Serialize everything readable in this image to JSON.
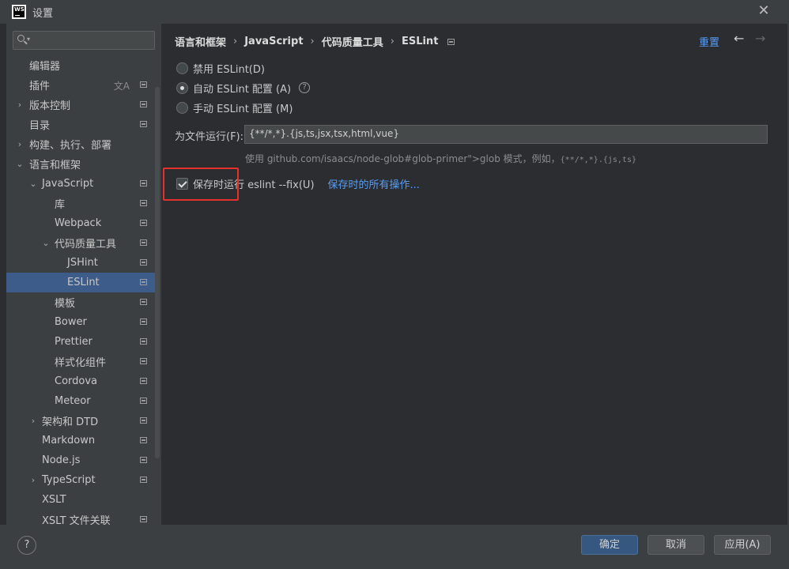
{
  "window": {
    "title": "设置",
    "logo_text": "WS"
  },
  "sidebar": {
    "search_placeholder": "Q",
    "items": [
      {
        "label": "编辑器"
      },
      {
        "label": "插件"
      },
      {
        "label": "版本控制"
      },
      {
        "label": "目录"
      },
      {
        "label": "构建、执行、部署"
      },
      {
        "label": "语言和框架"
      },
      {
        "label": "JavaScript"
      },
      {
        "label": "库"
      },
      {
        "label": "Webpack"
      },
      {
        "label": "代码质量工具"
      },
      {
        "label": "JSHint"
      },
      {
        "label": "ESLint"
      },
      {
        "label": "模板"
      },
      {
        "label": "Bower"
      },
      {
        "label": "Prettier"
      },
      {
        "label": "样式化组件"
      },
      {
        "label": "Cordova"
      },
      {
        "label": "Meteor"
      },
      {
        "label": "架构和 DTD"
      },
      {
        "label": "Markdown"
      },
      {
        "label": "Node.js"
      },
      {
        "label": "TypeScript"
      },
      {
        "label": "XSLT"
      },
      {
        "label": "XSLT 文件关联"
      }
    ]
  },
  "content": {
    "breadcrumb": [
      "语言和框架",
      "JavaScript",
      "代码质量工具",
      "ESLint"
    ],
    "reset_label": "重置",
    "radios": [
      {
        "label": "禁用 ESLint(D)",
        "checked": false
      },
      {
        "label": "自动 ESLint 配置 (A)",
        "checked": true
      },
      {
        "label": "手动 ESLint 配置 (M)",
        "checked": false
      }
    ],
    "file_label": "为文件运行(F):",
    "file_value": "{**/*,*}.{js,ts,jsx,tsx,html,vue}",
    "hint_prefix": "使用 github.com/isaacs/node-glob#glob-primer\">glob 模式，例如，",
    "hint_code": "{**/*,*}.{js,ts}",
    "save_checkbox_label": "保存时运行 eslint --fix(U)",
    "save_checked": true,
    "save_actions_link": "保存时的所有操作..."
  },
  "footer": {
    "help": "?",
    "ok": "确定",
    "cancel": "取消",
    "apply": "应用(A)"
  },
  "colors": {
    "accent": "#589df6",
    "highlight": "#e5302c",
    "selected": "#3d5c8a"
  }
}
